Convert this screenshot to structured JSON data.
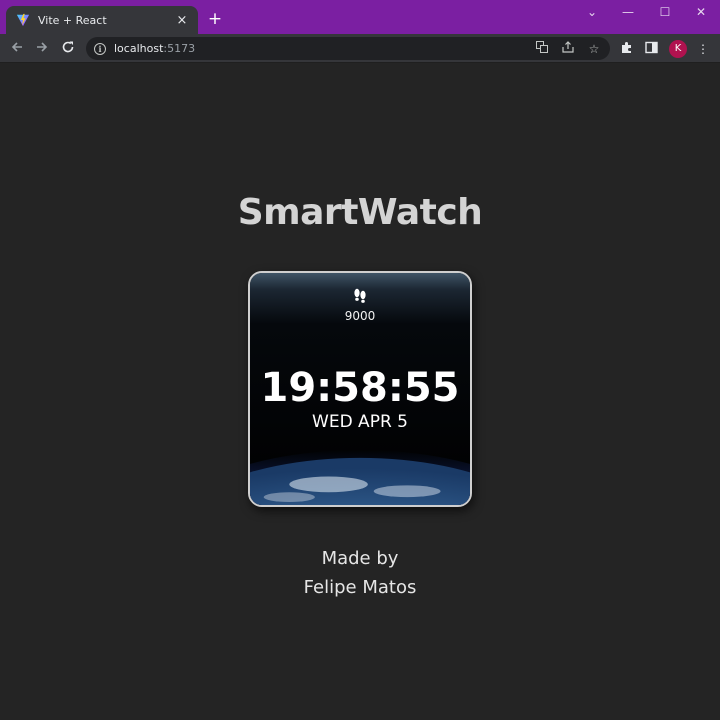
{
  "browser": {
    "tab_title": "Vite + React",
    "tab_close": "×",
    "new_tab": "+",
    "window_controls": {
      "minimize": "—",
      "maximize": "☐",
      "close": "✕",
      "dropdown": "⌄"
    },
    "url_host": "localhost",
    "url_port": ":5173",
    "profile_initial": "K",
    "accent_color": "#7b1fa2"
  },
  "page": {
    "title": "SmartWatch",
    "watch": {
      "steps": "9000",
      "steps_icon": "footprints-icon",
      "time": "19:58:55",
      "date": "WED APR 5"
    },
    "credit_line1": "Made by",
    "credit_line2": "Felipe Matos"
  }
}
